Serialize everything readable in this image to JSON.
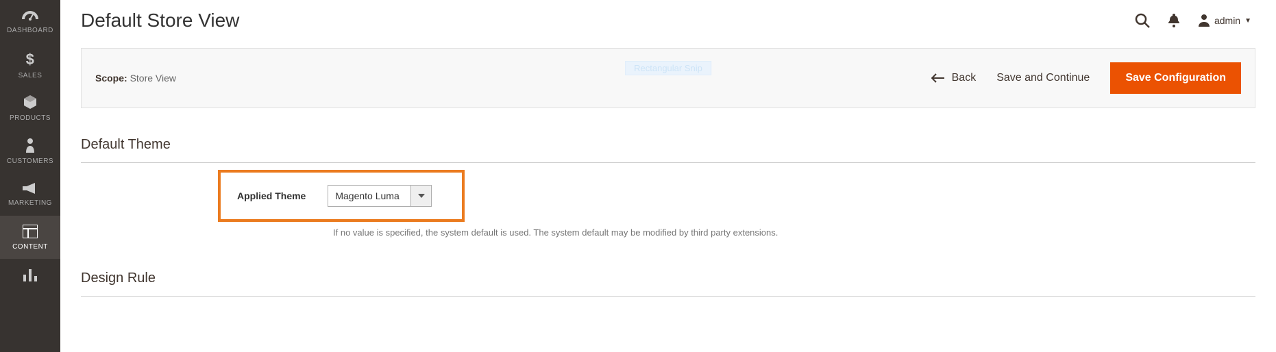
{
  "sidebar": {
    "items": [
      {
        "icon": "gauge-icon",
        "label": "DASHBOARD"
      },
      {
        "icon": "dollar-icon",
        "label": "SALES"
      },
      {
        "icon": "cube-icon",
        "label": "PRODUCTS"
      },
      {
        "icon": "person-icon",
        "label": "CUSTOMERS"
      },
      {
        "icon": "megaphone-icon",
        "label": "MARKETING"
      },
      {
        "icon": "layout-icon",
        "label": "CONTENT"
      },
      {
        "icon": "bars-icon",
        "label": ""
      }
    ],
    "active_index": 5
  },
  "header": {
    "title": "Default Store View",
    "user": "admin"
  },
  "toolbar": {
    "scope_label": "Scope:",
    "scope_value": "Store View",
    "snip_hint": "Rectangular Snip",
    "back_label": "Back",
    "save_continue_label": "Save and Continue",
    "save_config_label": "Save Configuration"
  },
  "section_default_theme": {
    "title": "Default Theme",
    "field_label": "Applied Theme",
    "select_value": "Magento Luma",
    "note": "If no value is specified, the system default is used. The system default may be modified by third party extensions."
  },
  "section_design_rule": {
    "title": "Design Rule"
  }
}
